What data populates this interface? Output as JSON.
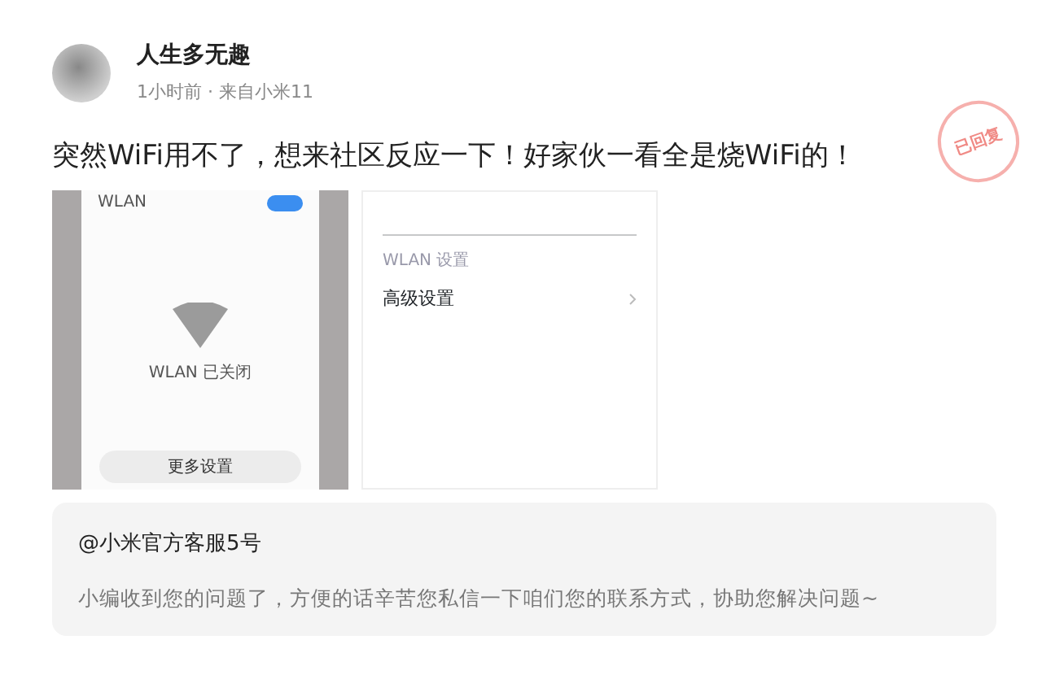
{
  "post": {
    "author": "人生多无趣",
    "meta": "1小时前 · 来自小米11",
    "text": "突然WiFi用不了，想来社区反应一下！好家伙一看全是烧WiFi的！",
    "stamp": "已回复"
  },
  "images": [
    {
      "kind": "wifi-off",
      "title": "WLAN",
      "toggle_on": true,
      "status": "WLAN 已关闭",
      "button": "更多设置"
    },
    {
      "kind": "settings",
      "section": "WLAN 设置",
      "item": "高级设置"
    }
  ],
  "reply": {
    "author": "@小米官方客服5号",
    "text": "小编收到您的问题了，方便的话辛苦您私信一下咱们您的联系方式，协助您解决问题~"
  }
}
